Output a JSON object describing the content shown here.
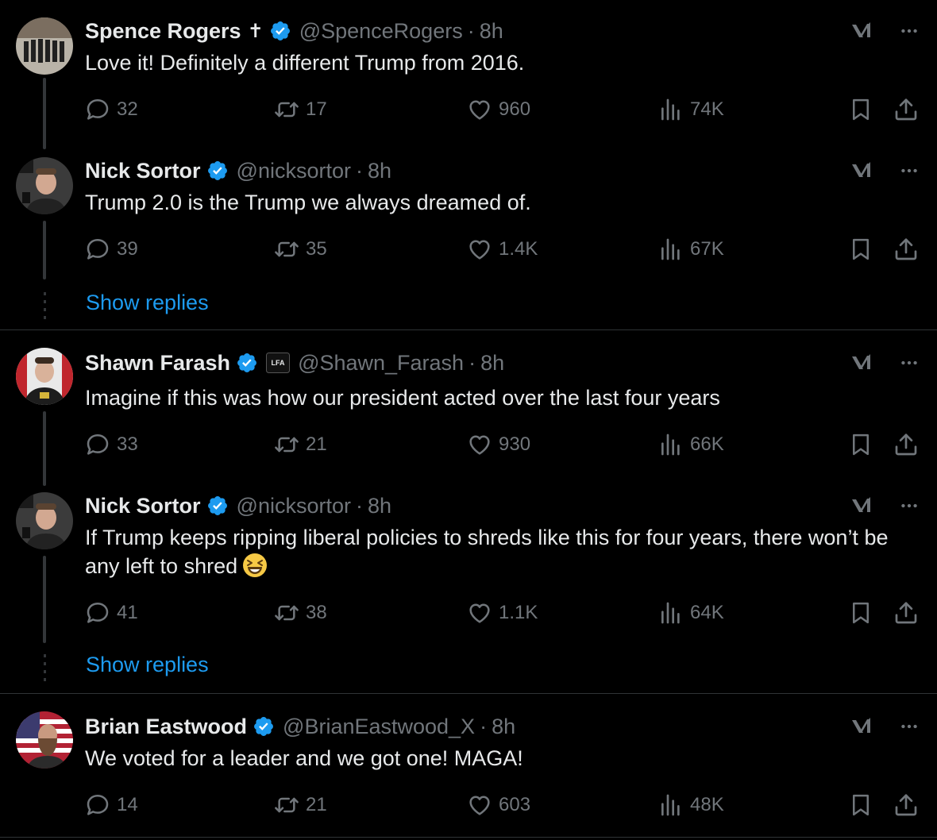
{
  "colors": {
    "background": "#000000",
    "text": "#e7e9ea",
    "muted": "#71767b",
    "accent": "#1d9bf0",
    "divider": "#2f3336"
  },
  "icons": {
    "reply": "speech-bubble-icon",
    "repost": "repost-arrows-icon",
    "like": "heart-icon",
    "views": "bar-chart-icon",
    "bookmark": "bookmark-icon",
    "share": "share-upload-icon",
    "grok": "grok-slash-icon",
    "more": "more-dots-icon",
    "verified": "blue-check-badge-icon"
  },
  "posts": [
    {
      "name": "Spence Rogers",
      "name_extra": "✝",
      "handle": "@SpenceRogers",
      "sep": "·",
      "time": "8h",
      "text": "Love it! Definitely a different Trump from 2016.",
      "replies": "32",
      "reposts": "17",
      "likes": "960",
      "views": "74K"
    },
    {
      "name": "Nick Sortor",
      "handle": "@nicksortor",
      "sep": "·",
      "time": "8h",
      "text": "Trump 2.0 is the Trump we always dreamed of.",
      "replies": "39",
      "reposts": "35",
      "likes": "1.4K",
      "views": "67K"
    },
    {
      "name": "Shawn Farash",
      "affiliation_badge": "LFA",
      "handle": "@Shawn_Farash",
      "sep": "·",
      "time": "8h",
      "text": "Imagine if this was how our president acted over the last four years",
      "replies": "33",
      "reposts": "21",
      "likes": "930",
      "views": "66K"
    },
    {
      "name": "Nick Sortor",
      "handle": "@nicksortor",
      "sep": "·",
      "time": "8h",
      "text": "If Trump keeps ripping liberal policies to shreds like this for four years, there won’t be any left to shred",
      "emoji": "grinning-squinting-face-emoji",
      "replies": "41",
      "reposts": "38",
      "likes": "1.1K",
      "views": "64K"
    },
    {
      "name": "Brian Eastwood",
      "handle": "@BrianEastwood_X",
      "sep": "·",
      "time": "8h",
      "text": "We voted for a leader and we got one! MAGA!",
      "replies": "14",
      "reposts": "21",
      "likes": "603",
      "views": "48K"
    }
  ],
  "show_replies_label": "Show replies"
}
